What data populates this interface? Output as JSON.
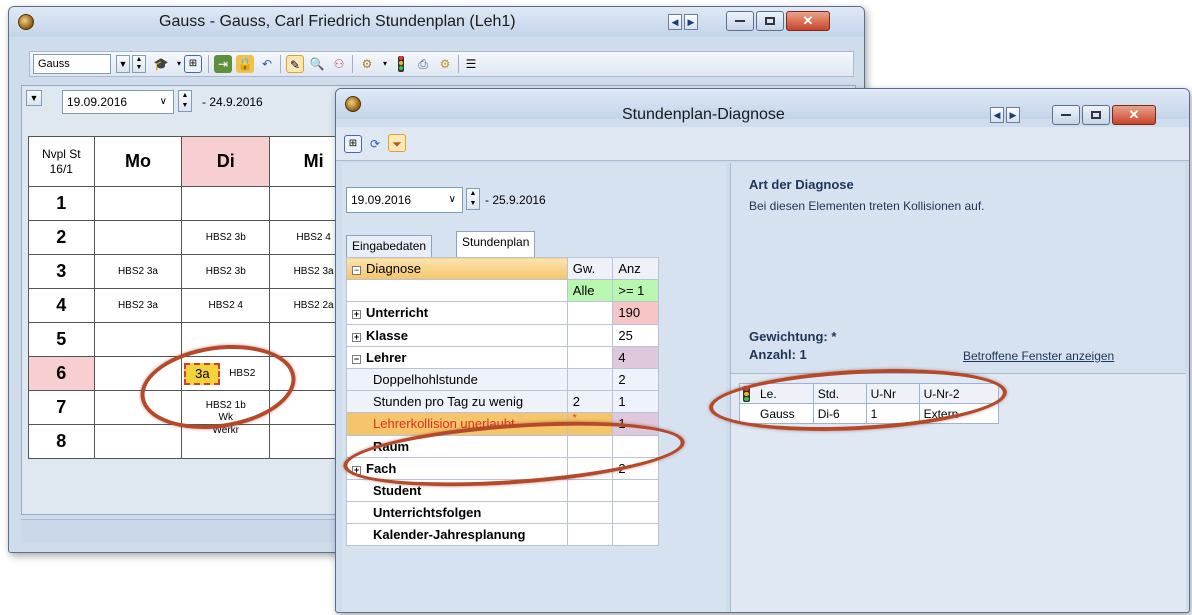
{
  "main_window": {
    "title": "Gauss - Gauss, Carl Friedrich  Stundenplan  (Leh1)",
    "element_select": "Gauss",
    "date_from": "19.09.2016",
    "date_to": "- 24.9.2016",
    "corner_header_line1": "Nvpl St",
    "corner_header_line2": "16/1",
    "days": [
      "Mo",
      "Di",
      "Mi"
    ],
    "periods": [
      "1",
      "2",
      "3",
      "4",
      "5",
      "6",
      "7",
      "8"
    ],
    "cells": {
      "p2_di": "HBS2 3b",
      "p2_mi": "HBS2 4",
      "p3_mo": "HBS2 3a",
      "p3_di": "HBS2 3b",
      "p3_mi": "HBS2 3a",
      "p4_mo": "HBS2 3a",
      "p4_di": "HBS2 4",
      "p4_mi": "HBS2 2a",
      "p6_class": "3a",
      "p6_rest": "HBS2",
      "p7_di": "HBS2 1b",
      "p7_di_2": "Wk",
      "p8_di": "Werkr"
    }
  },
  "diag_window": {
    "title": "Stundenplan-Diagnose",
    "date_from": "19.09.2016",
    "date_to": "- 25.9.2016",
    "tabs": [
      "Eingabedaten",
      "Stundenplan"
    ],
    "grid_headers": [
      "Diagnose",
      "Gw.",
      "Anz"
    ],
    "filter_row": {
      "gw": "Alle",
      "anz": ">= 1"
    },
    "rows": [
      {
        "label": "Unterricht",
        "gw": "",
        "anz": "190"
      },
      {
        "label": "Klasse",
        "gw": "",
        "anz": "25"
      },
      {
        "label": "Lehrer",
        "gw": "",
        "anz": "4"
      },
      {
        "label": "Doppelhohlstunde",
        "gw": "",
        "anz": "2"
      },
      {
        "label": "Stunden pro Tag zu wenig",
        "gw": "2",
        "anz": "1"
      },
      {
        "label": "Lehrerkollision unerlaubt",
        "gw": "*",
        "anz": "1"
      },
      {
        "label": "Raum",
        "gw": "",
        "anz": ""
      },
      {
        "label": "Fach",
        "gw": "",
        "anz": "2"
      },
      {
        "label": "Student",
        "gw": "",
        "anz": ""
      },
      {
        "label": "Unterrichtsfolgen",
        "gw": "",
        "anz": ""
      },
      {
        "label": "Kalender-Jahresplanung",
        "gw": "",
        "anz": ""
      }
    ],
    "art_title": "Art der Diagnose",
    "art_text": "Bei diesen Elementen treten Kollisionen auf.",
    "gewichtung": "Gewichtung: *",
    "anzahl": "Anzahl: 1",
    "show_windows_link": "Betroffene Fenster anzeigen",
    "collision_headers": [
      "Le.",
      "Std.",
      "U-Nr",
      "U-Nr-2"
    ],
    "collision_row": [
      "Gauss",
      "Di-6",
      "1",
      "Extern"
    ]
  },
  "colors": {
    "highlight_ellipse": "#b5492a",
    "today_header": "#f8cfd0",
    "selected_row": "#f5c56b",
    "error_text": "#e0301e",
    "filter_green": "#b9f7b0",
    "anz_red": "#f6c6c6",
    "anz_purple": "#e0c8dc"
  }
}
